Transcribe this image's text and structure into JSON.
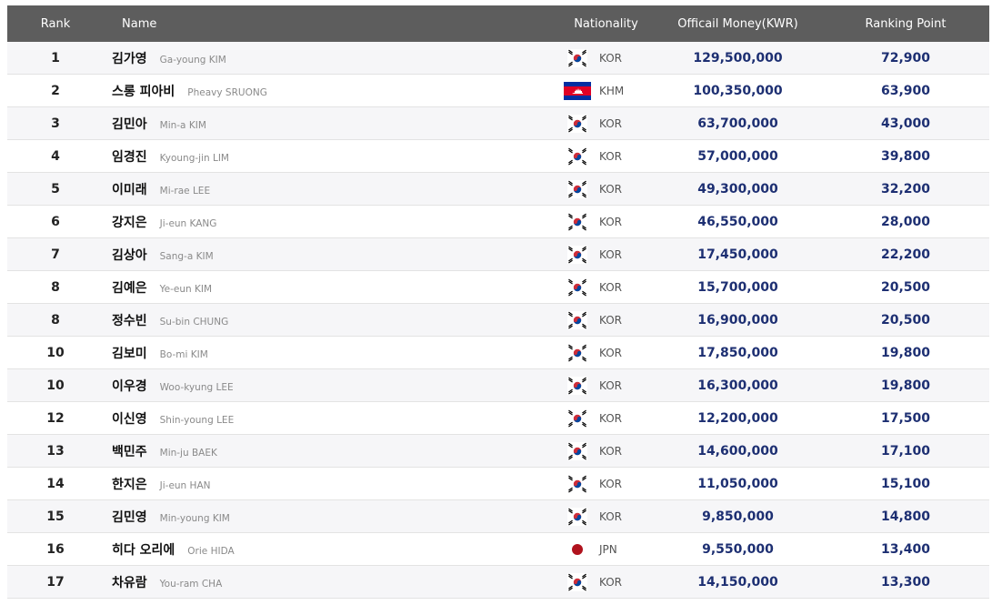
{
  "header": {
    "rank": "Rank",
    "name": "Name",
    "nationality": "Nationality",
    "money": "Officail Money(KWR)",
    "point": "Ranking Point"
  },
  "rows": [
    {
      "rank": "1",
      "kname": "김가영",
      "ename": "Ga-young KIM",
      "flag": "kor-flag-icon",
      "nat": "KOR",
      "money": "129,500,000",
      "point": "72,900"
    },
    {
      "rank": "2",
      "kname": "스롱 피아비",
      "ename": "Pheavy SRUONG",
      "flag": "khm-flag-icon",
      "nat": "KHM",
      "money": "100,350,000",
      "point": "63,900"
    },
    {
      "rank": "3",
      "kname": "김민아",
      "ename": "Min-a KIM",
      "flag": "kor-flag-icon",
      "nat": "KOR",
      "money": "63,700,000",
      "point": "43,000"
    },
    {
      "rank": "4",
      "kname": "임경진",
      "ename": "Kyoung-jin LIM",
      "flag": "kor-flag-icon",
      "nat": "KOR",
      "money": "57,000,000",
      "point": "39,800"
    },
    {
      "rank": "5",
      "kname": "이미래",
      "ename": "Mi-rae LEE",
      "flag": "kor-flag-icon",
      "nat": "KOR",
      "money": "49,300,000",
      "point": "32,200"
    },
    {
      "rank": "6",
      "kname": "강지은",
      "ename": "Ji-eun KANG",
      "flag": "kor-flag-icon",
      "nat": "KOR",
      "money": "46,550,000",
      "point": "28,000"
    },
    {
      "rank": "7",
      "kname": "김상아",
      "ename": "Sang-a KIM",
      "flag": "kor-flag-icon",
      "nat": "KOR",
      "money": "17,450,000",
      "point": "22,200"
    },
    {
      "rank": "8",
      "kname": "김예은",
      "ename": "Ye-eun KIM",
      "flag": "kor-flag-icon",
      "nat": "KOR",
      "money": "15,700,000",
      "point": "20,500"
    },
    {
      "rank": "8",
      "kname": "정수빈",
      "ename": "Su-bin CHUNG",
      "flag": "kor-flag-icon",
      "nat": "KOR",
      "money": "16,900,000",
      "point": "20,500"
    },
    {
      "rank": "10",
      "kname": "김보미",
      "ename": "Bo-mi KIM",
      "flag": "kor-flag-icon",
      "nat": "KOR",
      "money": "17,850,000",
      "point": "19,800"
    },
    {
      "rank": "10",
      "kname": "이우경",
      "ename": "Woo-kyung LEE",
      "flag": "kor-flag-icon",
      "nat": "KOR",
      "money": "16,300,000",
      "point": "19,800"
    },
    {
      "rank": "12",
      "kname": "이신영",
      "ename": "Shin-young LEE",
      "flag": "kor-flag-icon",
      "nat": "KOR",
      "money": "12,200,000",
      "point": "17,500"
    },
    {
      "rank": "13",
      "kname": "백민주",
      "ename": "Min-ju BAEK",
      "flag": "kor-flag-icon",
      "nat": "KOR",
      "money": "14,600,000",
      "point": "17,100"
    },
    {
      "rank": "14",
      "kname": "한지은",
      "ename": "Ji-eun HAN",
      "flag": "kor-flag-icon",
      "nat": "KOR",
      "money": "11,050,000",
      "point": "15,100"
    },
    {
      "rank": "15",
      "kname": "김민영",
      "ename": "Min-young KIM",
      "flag": "kor-flag-icon",
      "nat": "KOR",
      "money": "9,850,000",
      "point": "14,800"
    },
    {
      "rank": "16",
      "kname": "히다 오리에",
      "ename": "Orie HIDA",
      "flag": "jpn-flag-icon",
      "nat": "JPN",
      "money": "9,550,000",
      "point": "13,400"
    },
    {
      "rank": "17",
      "kname": "차유람",
      "ename": "You-ram CHA",
      "flag": "kor-flag-icon",
      "nat": "KOR",
      "money": "14,150,000",
      "point": "13,300"
    }
  ],
  "colors": {
    "header_bg": "#5d5d5d",
    "money_text": "#1d2f72",
    "row_alt": "#f6f6f8"
  }
}
